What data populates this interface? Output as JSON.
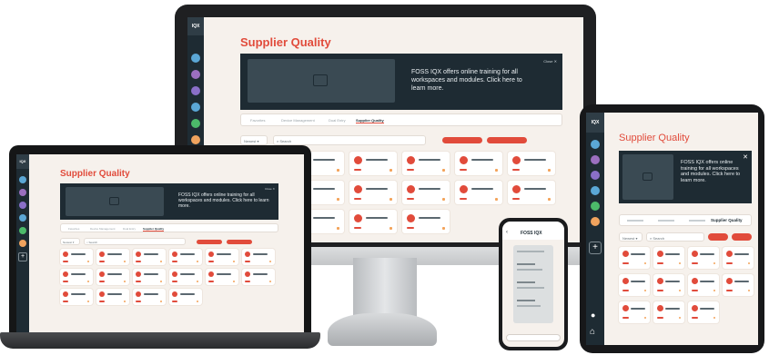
{
  "app": {
    "logo_text": "IQX",
    "page_title": "Supplier Quality",
    "banner": {
      "message": "FOSS IQX offers online training for all workspaces and modules. Click here to learn more.",
      "close_label": "Close"
    },
    "tabs": [
      "Favorites",
      "Device Management",
      "Dual Entry",
      "Supplier Quality"
    ],
    "active_tab": "Supplier Quality",
    "sort_label": "Newest",
    "search_placeholder": "Search",
    "rail_dot_colors": [
      "#5ba7d6",
      "#9b6fc0",
      "#8a6fc8",
      "#5ba7d6",
      "#4cba6a",
      "#f0a35e"
    ],
    "accent": "#e14b3b",
    "dark": "#1e2b33"
  },
  "phone": {
    "title": "FOSS IQX"
  }
}
